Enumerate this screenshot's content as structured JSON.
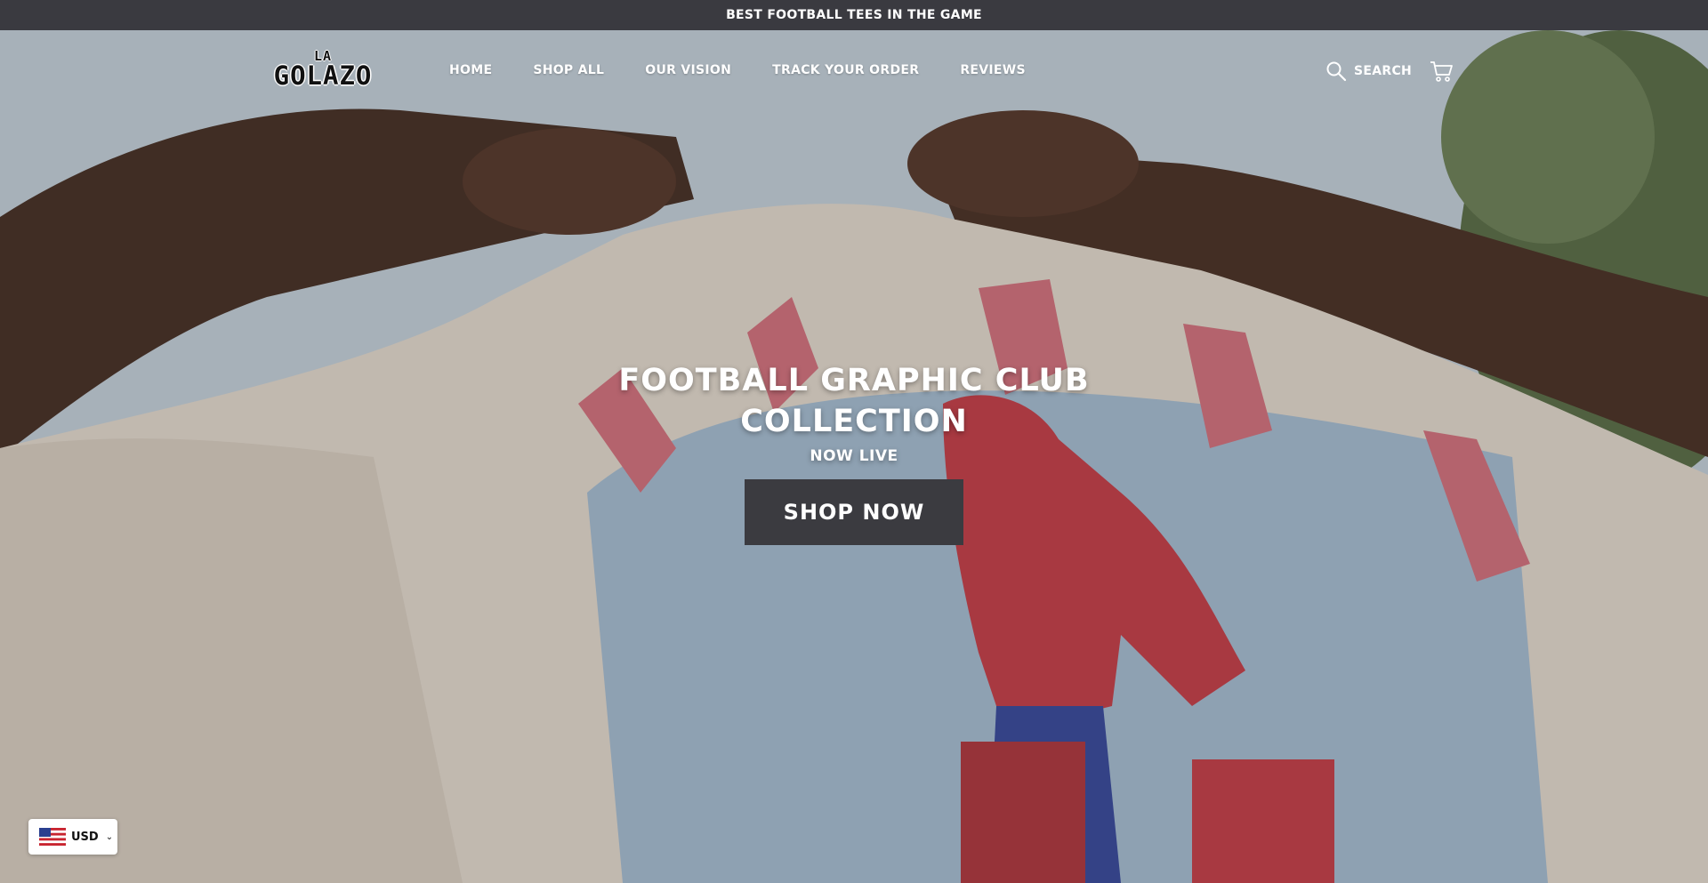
{
  "announcement": {
    "text": "BEST FOOTBALL TEES IN THE GAME"
  },
  "brand": {
    "logo_line1": "LA",
    "logo_line2": "GOLAZO"
  },
  "nav": {
    "items": [
      {
        "label": "HOME"
      },
      {
        "label": "SHOP ALL"
      },
      {
        "label": "OUR VISION"
      },
      {
        "label": "TRACK YOUR ORDER"
      },
      {
        "label": "REVIEWS"
      }
    ],
    "search_label": "SEARCH"
  },
  "hero": {
    "title": "FOOTBALL GRAPHIC CLUB COLLECTION",
    "subtitle": "NOW LIVE",
    "cta_label": "SHOP NOW"
  },
  "currency": {
    "code": "USD"
  },
  "colors": {
    "announcement_bg": "#3a3a40",
    "cta_bg": "#3b3b40",
    "text": "#ffffff"
  },
  "icons": [
    "search-icon",
    "cart-icon",
    "us-flag-icon",
    "chevron-down-icon"
  ]
}
